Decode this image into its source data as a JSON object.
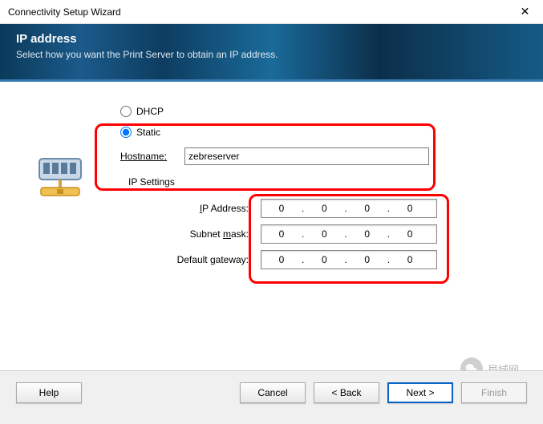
{
  "titlebar": {
    "title": "Connectivity Setup Wizard"
  },
  "header": {
    "title": "IP address",
    "subtitle": "Select how you want the Print Server to obtain an IP address."
  },
  "options": {
    "dhcp_label": "DHCP",
    "static_label": "Static",
    "selected": "static"
  },
  "hostname": {
    "label": "Hostname:",
    "value": "zebreserver"
  },
  "ip_settings": {
    "section_label": "IP Settings",
    "rows": [
      {
        "label": "IP Address:",
        "octets": [
          "0",
          "0",
          "0",
          "0"
        ]
      },
      {
        "label": "Subnet mask:",
        "octets": [
          "0",
          "0",
          "0",
          "0"
        ]
      },
      {
        "label": "Default gateway:",
        "octets": [
          "0",
          "0",
          "0",
          "0"
        ]
      }
    ]
  },
  "footer": {
    "help": "Help",
    "cancel": "Cancel",
    "back": "< Back",
    "next": "Next >",
    "finish": "Finish"
  },
  "watermark": {
    "text": "局域网"
  }
}
